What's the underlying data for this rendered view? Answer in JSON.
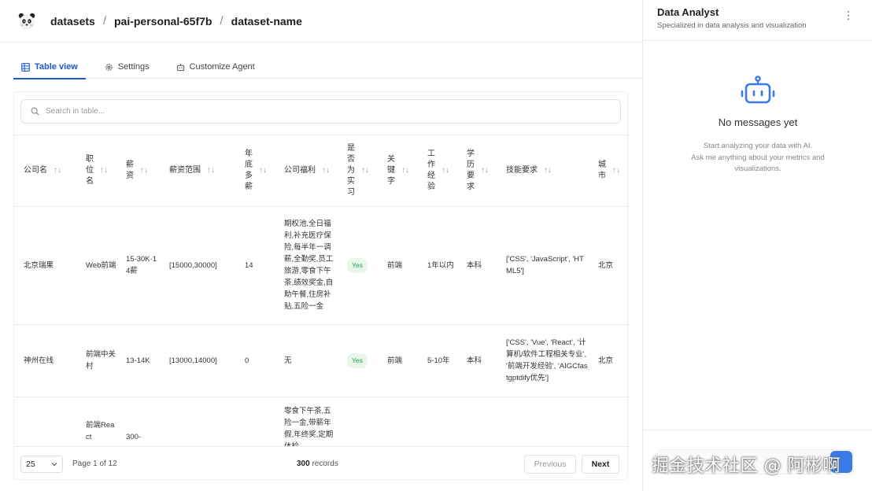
{
  "breadcrumb": [
    "datasets",
    "pai-personal-65f7b",
    "dataset-name"
  ],
  "tabs": [
    {
      "label": "Table view",
      "icon": "table-icon",
      "active": true
    },
    {
      "label": "Settings",
      "icon": "gear-icon",
      "active": false
    },
    {
      "label": "Customize Agent",
      "icon": "robot-icon",
      "active": false
    }
  ],
  "search": {
    "placeholder": "Search in table..."
  },
  "table": {
    "columns": [
      "公司名",
      "职位名",
      "薪资",
      "薪资范围",
      "年底多薪",
      "公司福利",
      "是否为实习",
      "关键字",
      "工作经验",
      "学历要求",
      "技能要求",
      "城市"
    ],
    "rows": [
      [
        "北京瑞果",
        "Web前端",
        "15-30K·14薪",
        "[15000,30000]",
        "14",
        "期权池,全日福利,补充医疗保险,每半年一调薪,全勤奖,员工旅游,零食下午茶,绩效奖金,自助午餐,住房补贴,五险一金",
        "Yes",
        "前端",
        "1年以内",
        "本科",
        "['CSS', 'JavaScript', 'HTML5']",
        "北京"
      ],
      [
        "神州在线",
        "前端中关村",
        "13-14K",
        "[13000,14000]",
        "0",
        "无",
        "Yes",
        "前端",
        "5-10年",
        "本科",
        "['CSS', 'Vue', 'React', '计算机/软件工程相关专业', '前端开发经验', 'AIGCfastgptdify优先']",
        "北京"
      ],
      [
        "",
        "前端React",
        "300-",
        "",
        "",
        "零食下午茶,五险一金,带薪年假,年终奖,定期体检",
        "",
        "",
        "",
        "",
        "",
        ""
      ]
    ]
  },
  "pagination": {
    "page_size": "25",
    "page_info": "Page 1 of 12",
    "records_count": "300",
    "records_label": "records",
    "prev_label": "Previous",
    "next_label": "Next"
  },
  "panel": {
    "title": "Data Analyst",
    "subtitle": "Specialized in data analysis and visualization",
    "empty_title": "No messages yet",
    "empty_line1": "Start analyzing your data with AI.",
    "empty_line2": "Ask me anything about your metrics and",
    "empty_line3": "visualizations."
  },
  "watermark": "掘金技术社区 @ 阿彬啊",
  "colors": {
    "accent": "#1f57c8",
    "yes_bg": "#e7f7ea",
    "yes_text": "#2e9a4b",
    "robot": "#3a7be8"
  }
}
